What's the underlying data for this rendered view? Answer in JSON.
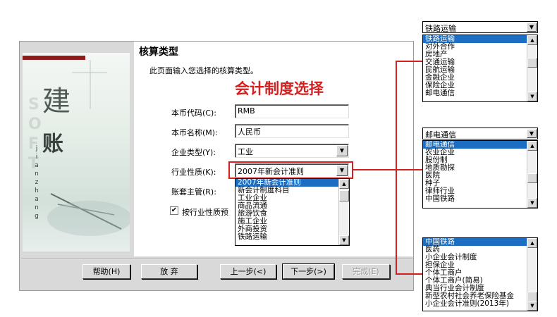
{
  "dialog": {
    "title": "核算类型",
    "subtitle": "此页面输入您选择的核算类型。",
    "annotation": "会计制度选择",
    "sidebar": {
      "char1": "建",
      "char2": "账",
      "letters": [
        "j",
        "i",
        "a",
        "n",
        "z",
        "h",
        "a",
        "n",
        "g"
      ]
    },
    "fields": {
      "currency_code": {
        "label": "本币代码(C):",
        "value": "RMB"
      },
      "currency_name": {
        "label": "本币名称(M):",
        "value": "人民币"
      },
      "company_type": {
        "label": "企业类型(Y):",
        "value": "工业"
      },
      "industry": {
        "label": "行业性质(K):",
        "value": "2007年新会计准则"
      },
      "supervisor": {
        "label": "账套主管(R):"
      }
    },
    "industry_list": [
      "2007年新会计准则",
      "新会计制度科目",
      "工业企业",
      "商品流通",
      "旅游饮食",
      "施工企业",
      "外商投资",
      "铁路运输"
    ],
    "checkbox": {
      "label": "按行业性质预",
      "checked": "✔"
    },
    "buttons": {
      "help": "帮助(H)",
      "cancel": "放 弃",
      "prev": "上一步(<)",
      "next": "下一步(>)",
      "finish": "完成(E)"
    }
  },
  "panels": [
    {
      "combo_value": "铁路运输",
      "items": [
        "铁路运输",
        "对外合作",
        "房地产",
        "交通运输",
        "民航运输",
        "金融企业",
        "保险企业",
        "邮电通信"
      ]
    },
    {
      "combo_value": "邮电通信",
      "items": [
        "邮电通信",
        "农业企业",
        "股份制",
        "地质勘探",
        "医院",
        "种子",
        "律师行业",
        "中国铁路"
      ]
    },
    {
      "items": [
        "中国铁路",
        "医药",
        "小企业会计制度",
        "担保企业",
        "个体工商户",
        "个体工商户(简易)",
        "典当行业会计制度",
        "新型农村社会养老保险基金",
        "小企业会计准则(2013年)"
      ]
    }
  ],
  "colors": {
    "accent_red": "#d32121",
    "selection_blue": "#1b6ec2",
    "dialog_gray": "#d9d9d9"
  }
}
